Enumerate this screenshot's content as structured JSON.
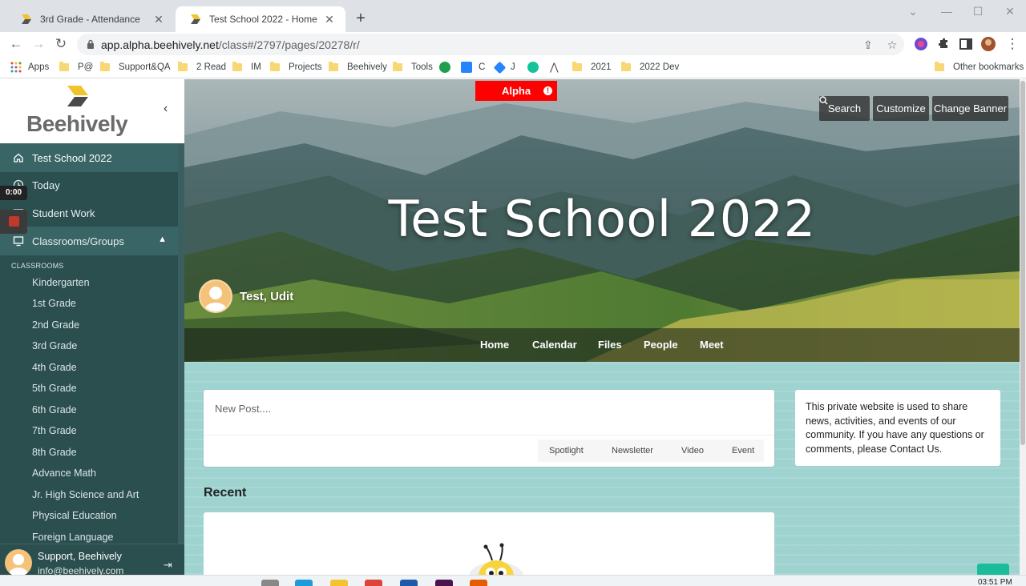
{
  "browser": {
    "tabs": [
      {
        "title": "3rd Grade - Attendance",
        "active": false
      },
      {
        "title": "Test School 2022 - Home",
        "active": true
      }
    ],
    "url_host": "app.alpha.beehively.net",
    "url_path": "/class#/2797/pages/20278/r/",
    "bookmarks": [
      "Apps",
      "P@",
      "Support&QA",
      "2 Read",
      "IM",
      "Projects",
      "Beehively",
      "Tools",
      "C",
      "J",
      "2021",
      "2022 Dev",
      "Other bookmarks"
    ]
  },
  "sidebar": {
    "logo_text": "Beehively",
    "items": [
      {
        "label": "Test School 2022"
      },
      {
        "label": "Today"
      },
      {
        "label": "Student Work"
      },
      {
        "label": "Classrooms/Groups"
      }
    ],
    "classrooms_heading": "CLASSROOMS",
    "classrooms": [
      "Kindergarten",
      "1st Grade",
      "2nd Grade",
      "3rd Grade",
      "4th Grade",
      "5th Grade",
      "6th Grade",
      "7th Grade",
      "8th Grade",
      "Advance Math",
      "Jr. High Science and Art",
      "Physical Education",
      "Foreign Language"
    ],
    "footer": {
      "name": "Support, Beehively",
      "email": "info@beehively.com"
    },
    "timer": "0:00"
  },
  "banner": {
    "alpha_label": "Alpha",
    "buttons": {
      "search": "Search",
      "customize": "Customize",
      "change_banner": "Change Banner"
    },
    "title": "Test School 2022",
    "owner": "Test, Udit",
    "nav": [
      "Home",
      "Calendar",
      "Files",
      "People",
      "Meet"
    ]
  },
  "content": {
    "post_placeholder": "New Post....",
    "post_types": [
      "Spotlight",
      "Newsletter",
      "Video",
      "Event"
    ],
    "info_text": "This private website is used to share news, activities, and events of our community. If you have any questions or comments, please Contact Us.",
    "recent_heading": "Recent"
  },
  "taskbar": {
    "clock": "03:51 PM"
  }
}
